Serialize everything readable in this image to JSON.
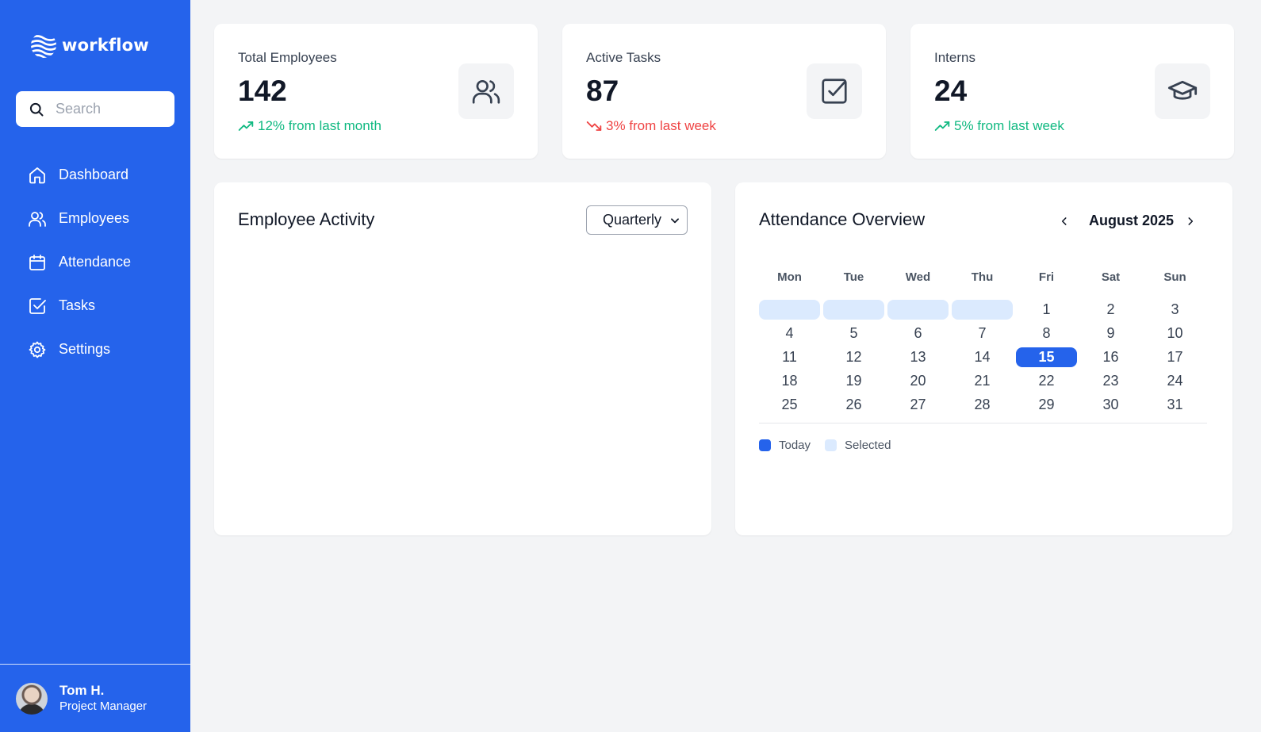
{
  "app": {
    "logo_text": "workflow",
    "search": {
      "placeholder": "Search",
      "value": ""
    }
  },
  "sidebar": {
    "items": [
      {
        "label": "Dashboard",
        "icon": "home-icon"
      },
      {
        "label": "Employees",
        "icon": "users-icon"
      },
      {
        "label": "Attendance",
        "icon": "calendar-icon"
      },
      {
        "label": "Tasks",
        "icon": "check-square-icon"
      },
      {
        "label": "Settings",
        "icon": "gear-icon"
      }
    ]
  },
  "profile": {
    "name": "Tom H.",
    "role": "Project Manager"
  },
  "stats": [
    {
      "title": "Total Employees",
      "value": "142",
      "trend": "12% from last month",
      "direction": "up",
      "icon": "users-icon"
    },
    {
      "title": "Active Tasks",
      "value": "87",
      "trend": "3% from last week",
      "direction": "down",
      "icon": "check-square-icon"
    },
    {
      "title": "Interns",
      "value": "24",
      "trend": "5% from last week",
      "direction": "up",
      "icon": "graduation-cap-icon"
    }
  ],
  "activity": {
    "title": "Employee Activity",
    "period": "Quarterly"
  },
  "attendance": {
    "title": "Attendance Overview",
    "month": "August 2025",
    "weekdays": [
      "Mon",
      "Tue",
      "Wed",
      "Thu",
      "Fri",
      "Sat",
      "Sun"
    ],
    "leading_blanks": 4,
    "days_in_month": 31,
    "today": 15,
    "legend": {
      "today": "Today",
      "selected": "Selected"
    }
  },
  "colors": {
    "primary": "#2563eb",
    "selected": "#dbeafe",
    "trend_up": "#10b981",
    "trend_down": "#ef4444",
    "background": "#f3f4f6"
  }
}
